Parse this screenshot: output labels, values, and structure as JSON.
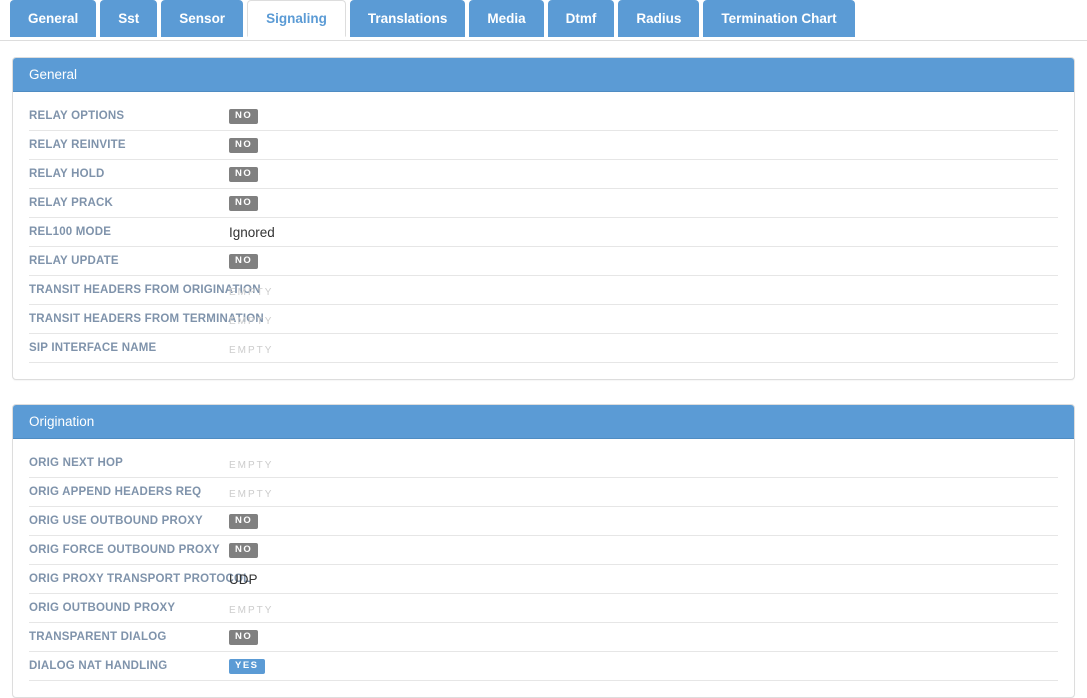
{
  "tabs": [
    {
      "label": "General",
      "active": false
    },
    {
      "label": "Sst",
      "active": false
    },
    {
      "label": "Sensor",
      "active": false
    },
    {
      "label": "Signaling",
      "active": true
    },
    {
      "label": "Translations",
      "active": false
    },
    {
      "label": "Media",
      "active": false
    },
    {
      "label": "Dtmf",
      "active": false
    },
    {
      "label": "Radius",
      "active": false
    },
    {
      "label": "Termination Chart",
      "active": false
    }
  ],
  "colors": {
    "primary": "#5b9bd5",
    "badge_no": "#808080",
    "badge_yes": "#5b9bd5",
    "label": "#7f93ab",
    "empty": "#cccccc"
  },
  "panels": [
    {
      "title": "General",
      "rows": [
        {
          "label": "RELAY OPTIONS",
          "value": "NO",
          "kind": "badge-no"
        },
        {
          "label": "RELAY REINVITE",
          "value": "NO",
          "kind": "badge-no"
        },
        {
          "label": "RELAY HOLD",
          "value": "NO",
          "kind": "badge-no"
        },
        {
          "label": "RELAY PRACK",
          "value": "NO",
          "kind": "badge-no"
        },
        {
          "label": "REL100 MODE",
          "value": "Ignored",
          "kind": "text"
        },
        {
          "label": "RELAY UPDATE",
          "value": "NO",
          "kind": "badge-no"
        },
        {
          "label": "TRANSIT HEADERS FROM ORIGINATION",
          "value": "EMPTY",
          "kind": "empty"
        },
        {
          "label": "TRANSIT HEADERS FROM TERMINATION",
          "value": "EMPTY",
          "kind": "empty"
        },
        {
          "label": "SIP INTERFACE NAME",
          "value": "EMPTY",
          "kind": "empty"
        }
      ]
    },
    {
      "title": "Origination",
      "rows": [
        {
          "label": "ORIG NEXT HOP",
          "value": "EMPTY",
          "kind": "empty"
        },
        {
          "label": "ORIG APPEND HEADERS REQ",
          "value": "EMPTY",
          "kind": "empty"
        },
        {
          "label": "ORIG USE OUTBOUND PROXY",
          "value": "NO",
          "kind": "badge-no"
        },
        {
          "label": "ORIG FORCE OUTBOUND PROXY",
          "value": "NO",
          "kind": "badge-no"
        },
        {
          "label": "ORIG PROXY TRANSPORT PROTOCOL",
          "value": "UDP",
          "kind": "text"
        },
        {
          "label": "ORIG OUTBOUND PROXY",
          "value": "EMPTY",
          "kind": "empty"
        },
        {
          "label": "TRANSPARENT DIALOG",
          "value": "NO",
          "kind": "badge-no"
        },
        {
          "label": "DIALOG NAT HANDLING",
          "value": "YES",
          "kind": "badge-yes"
        }
      ]
    }
  ]
}
